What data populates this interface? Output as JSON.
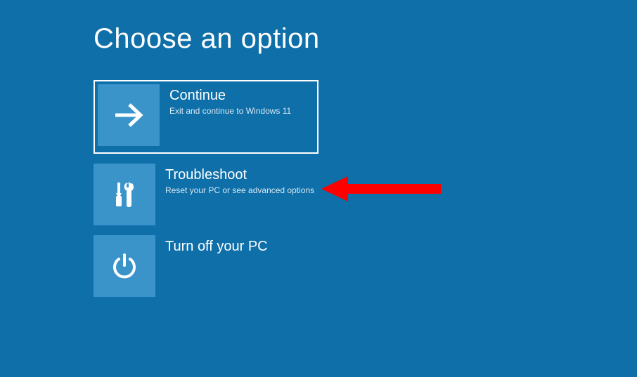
{
  "page_title": "Choose an option",
  "options": {
    "continue": {
      "title": "Continue",
      "description": "Exit and continue to Windows 11"
    },
    "troubleshoot": {
      "title": "Troubleshoot",
      "description": "Reset your PC or see advanced options"
    },
    "turnoff": {
      "title": "Turn off your PC",
      "description": ""
    }
  }
}
